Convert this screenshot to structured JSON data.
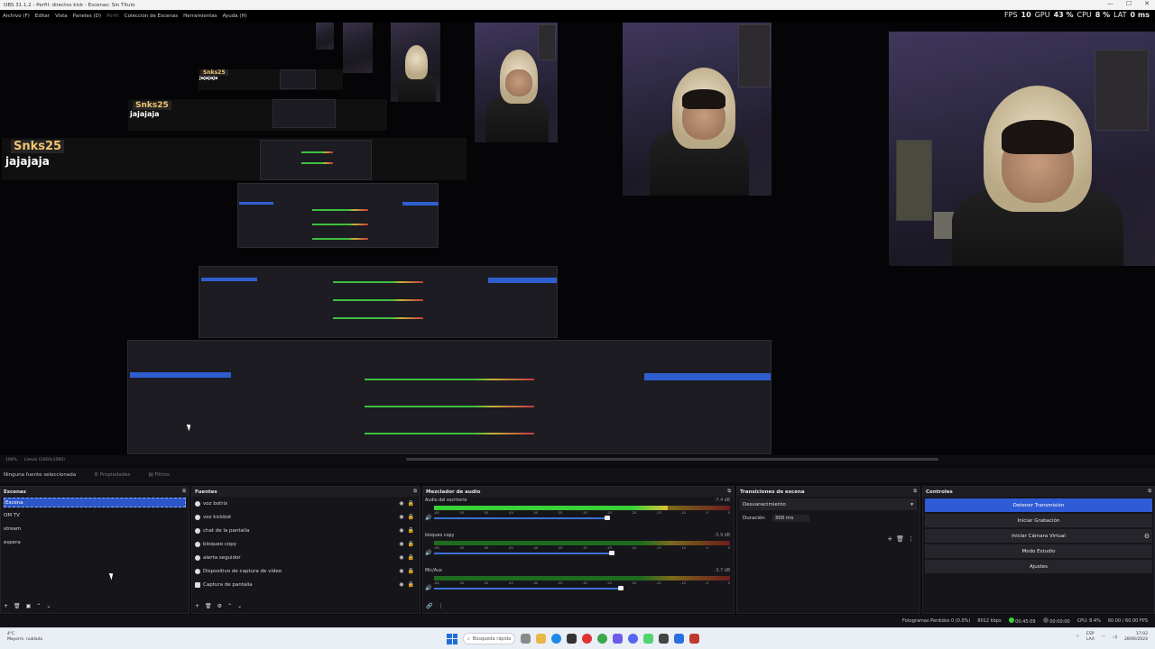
{
  "window": {
    "title": "OBS 31.1.2 - Perfil: directos kick - Escenas: Sin Título",
    "minimize": "—",
    "maximize": "☐",
    "close": "✕"
  },
  "menu": [
    "Archivo (F)",
    "Editar",
    "Vista",
    "Paneles (D)",
    "Perfil",
    "Colección de Escenas",
    "Herramientas",
    "Ayuda (H)"
  ],
  "stats": {
    "fps_label": "FPS",
    "fps": "10",
    "gpu_label": "GPU",
    "gpu": "43 %",
    "cpu_label": "CPU",
    "cpu": "8 %",
    "lat_label": "LAT",
    "lat": "0 ms"
  },
  "preview": {
    "chat_big": {
      "user": "Snks25",
      "msg": "jajajaja"
    },
    "chat_mid": {
      "user": "Snks25",
      "msg": "jajajaja"
    },
    "chat_small": {
      "user": "Snks25",
      "msg": "jajajaja"
    },
    "zoom": "100%",
    "canvas": "Lienzo (1920x1080)"
  },
  "context_bar": {
    "no_source": "Ninguna fuente seleccionada",
    "properties": "Propiedades",
    "filters": "Filtros"
  },
  "scenes": {
    "title": "Escenas",
    "items": [
      "Escena",
      "OM TV",
      "stream",
      "espera"
    ],
    "selected_index": 0
  },
  "sources": {
    "title": "Fuentes",
    "items": [
      "voz botrix",
      "voz kickbot",
      "chat de la pantalla",
      "bloqueo copy",
      "alerta seguidor",
      "Dispositivo de captura de vídeo",
      "Captura de pantalla"
    ]
  },
  "mixer": {
    "title": "Mezclador de audio",
    "channels": [
      {
        "name": "Audio del escritorio",
        "db": "-7.4 dB",
        "level": 0.79,
        "volume": 0.78
      },
      {
        "name": "bloqueo copy",
        "db": "-5.9 dB",
        "level": 0.0,
        "volume": 0.8
      },
      {
        "name": "Mic/Aux",
        "db": "-3.7 dB",
        "level": 0.0,
        "volume": 0.84
      }
    ],
    "ticks": [
      "-60",
      "-55",
      "-50",
      "-45",
      "-40",
      "-35",
      "-30",
      "-25",
      "-20",
      "-15",
      "-10",
      "-5",
      "0"
    ]
  },
  "transitions": {
    "title": "Transiciones de escena",
    "type": "Desvanecimiento",
    "duration_label": "Duración",
    "duration": "300 ms"
  },
  "controls": {
    "title": "Controles",
    "stop_stream": "Detener Transmisión",
    "start_record": "Iniciar Grabación",
    "virtual_cam": "Iniciar Cámara Virtual",
    "studio_mode": "Modo Estudio",
    "settings": "Ajustes"
  },
  "status": {
    "dropped": "Fotogramas Perdidos 0 (0.0%)",
    "bitrate": "8012 kbps",
    "stream_time": "00:45:09",
    "rec_time": "00:00:00",
    "cpu": "CPU: 8.4%",
    "fps": "60.00 / 60.00 FPS"
  },
  "taskbar": {
    "weather_temp": "4°C",
    "weather_desc": "Mayorm. nublado",
    "search_placeholder": "Búsqueda rápida",
    "lang": "ESP",
    "lang2": "LAA",
    "time": "17:02",
    "date": "28/06/2024"
  },
  "colors": {
    "accent": "#2f5bd6",
    "meter_green": "#39d239",
    "meter_yellow": "#e0c03a",
    "meter_red": "#c43a3a"
  }
}
